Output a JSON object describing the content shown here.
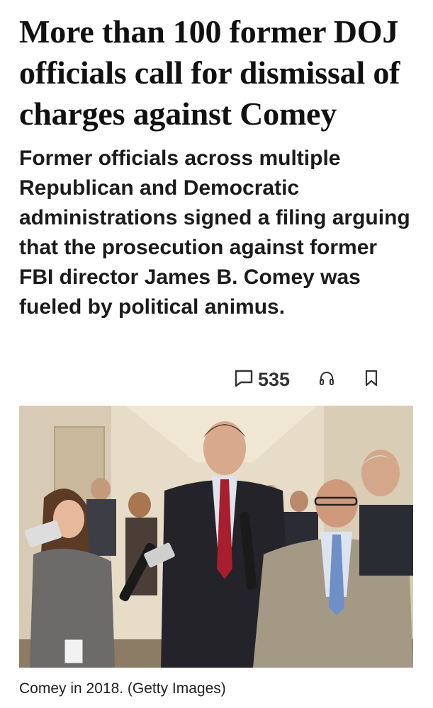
{
  "article": {
    "headline": "More than 100 former DOJ officials call for dismissal of charges against Comey",
    "dek": "Former officials across multiple Republican and Democratic administrations signed a filing arguing that the prosecution against former FBI director James B. Comey was fueled by political animus."
  },
  "actions": {
    "comment_count": "535",
    "icons": [
      "comment-icon",
      "headphones-icon",
      "bookmark-icon"
    ]
  },
  "photo": {
    "caption": "Comey in 2018. (Getty Images)"
  },
  "colors": {
    "text": "#111111",
    "icon": "#333333",
    "background": "#ffffff"
  }
}
